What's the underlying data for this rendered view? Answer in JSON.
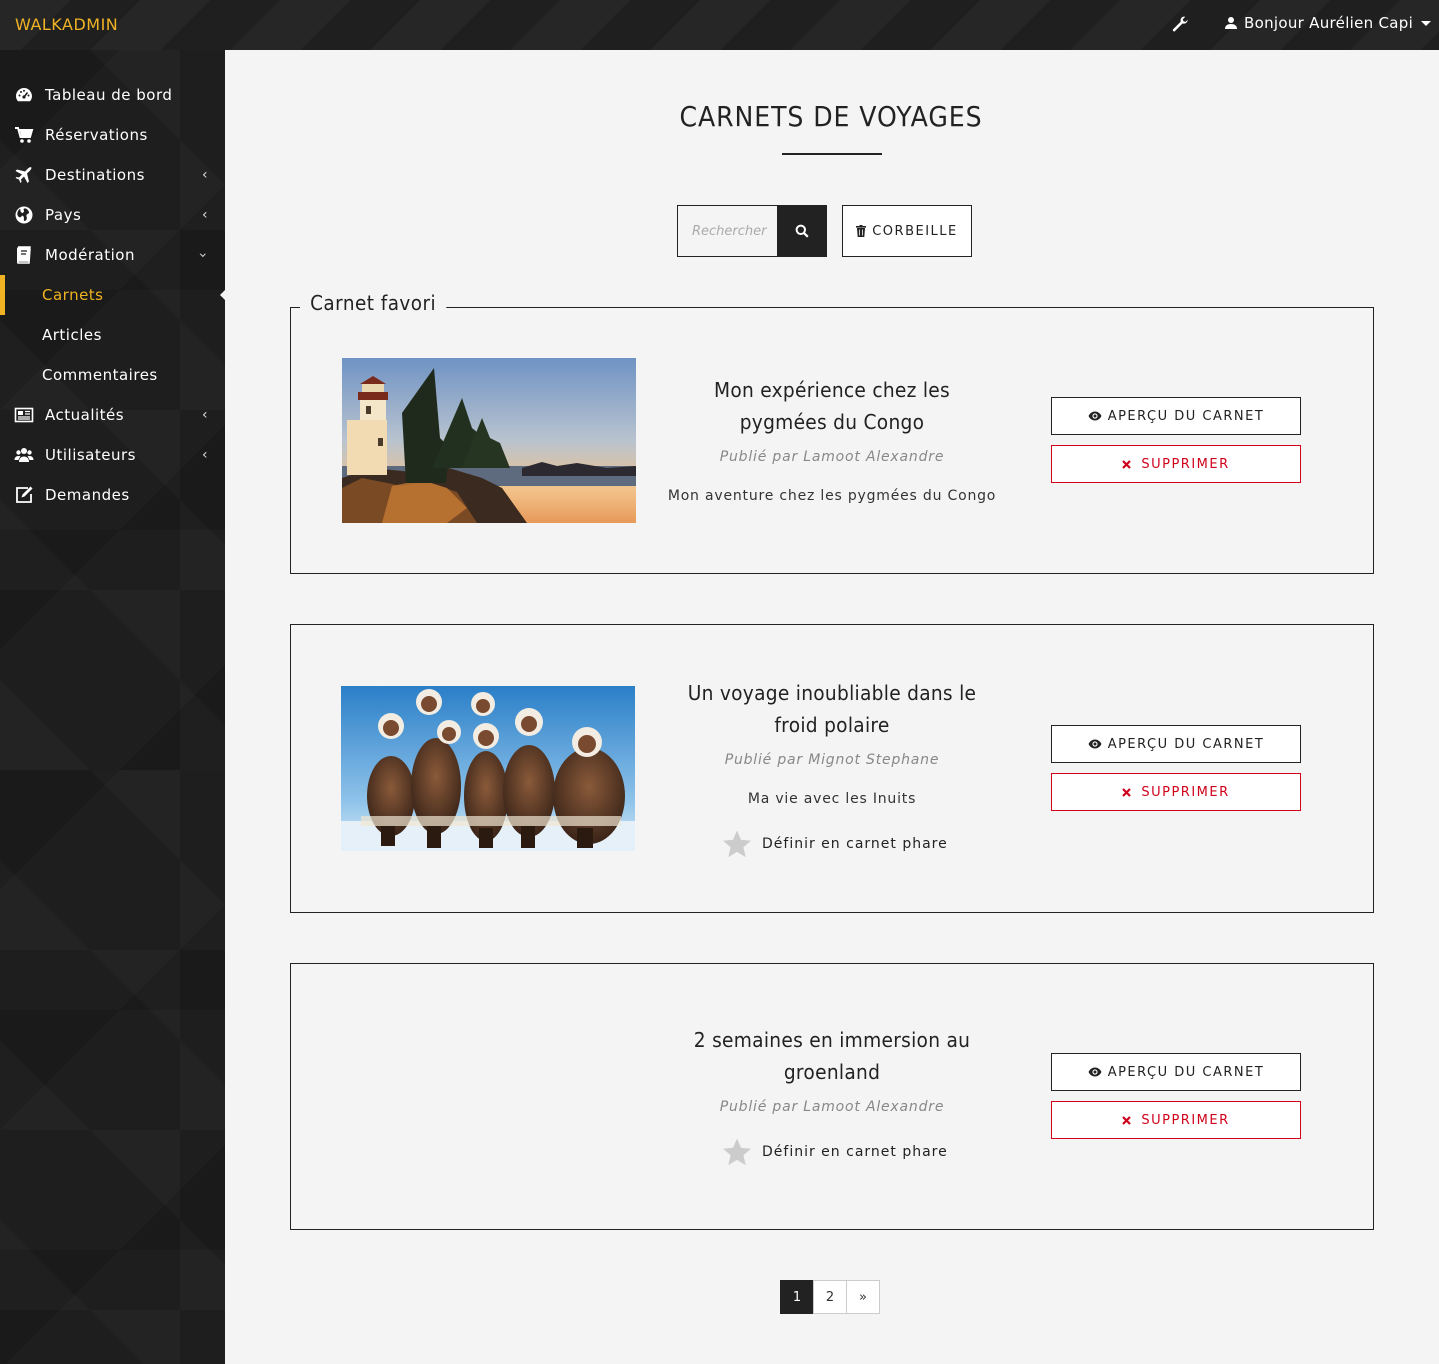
{
  "brand": "WALKADMIN",
  "header": {
    "settings_icon": "wrench-icon",
    "user_greeting": "Bonjour Aurélien Capi"
  },
  "sidebar": {
    "items": [
      {
        "label": "Tableau de bord",
        "icon": "dashboard-icon"
      },
      {
        "label": "Réservations",
        "icon": "cart-icon"
      },
      {
        "label": "Destinations",
        "icon": "plane-icon"
      },
      {
        "label": "Pays",
        "icon": "globe-icon"
      },
      {
        "label": "Modération",
        "icon": "book-icon"
      },
      {
        "label": "Actualités",
        "icon": "newspaper-icon"
      },
      {
        "label": "Utilisateurs",
        "icon": "users-icon"
      },
      {
        "label": "Demandes",
        "icon": "edit-icon"
      }
    ],
    "sub_items": [
      {
        "label": "Carnets",
        "active": true
      },
      {
        "label": "Articles",
        "active": false
      },
      {
        "label": "Commentaires",
        "active": false
      }
    ]
  },
  "main": {
    "title": "CARNETS DE VOYAGES",
    "search": {
      "placeholder": "Rechercher"
    },
    "trash_label": "CORBEILLE",
    "favorite_legend": "Carnet favori",
    "view_label": "APERÇU DU CARNET",
    "delete_label": "SUPPRIMER",
    "feature_label": "Définir en carnet phare",
    "cards": [
      {
        "title": "Mon expérience chez les pygmées du Congo",
        "author": "Publié par Lamoot Alexandre",
        "description": "Mon aventure chez les pygmées du Congo",
        "image": "lighthouse-sunset"
      },
      {
        "title": "Un voyage inoubliable dans le froid polaire",
        "author": "Publié par Mignot Stephane",
        "description": "Ma vie avec les Inuits",
        "image": "inuit-group"
      },
      {
        "title": "2 semaines en immersion au groenland",
        "author": "Publié par Lamoot Alexandre",
        "description": ""
      }
    ],
    "pagination": [
      "1",
      "2",
      "»"
    ],
    "current_page": "1"
  },
  "colors": {
    "accent": "#f0b323",
    "danger": "#d0021b",
    "dark": "#1e1e1e",
    "background": "#f4f4f4"
  }
}
